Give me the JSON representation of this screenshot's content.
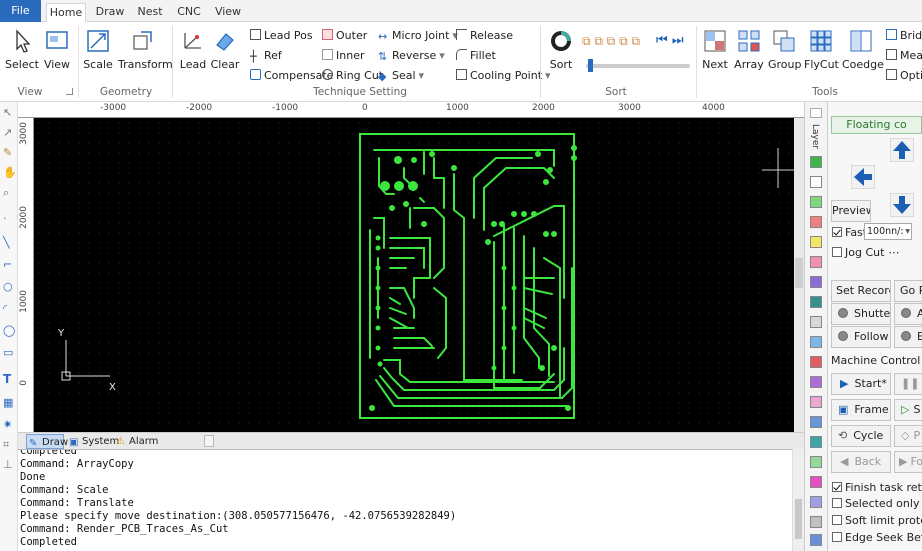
{
  "tabs": [
    "File",
    "Home",
    "Draw",
    "Nest",
    "CNC",
    "View"
  ],
  "ribbon": {
    "view_group": {
      "select": "Select",
      "view": "View",
      "label": "View"
    },
    "geometry_group": {
      "scale": "Scale",
      "transform": "Transform",
      "label": "Geometry"
    },
    "lead_clear": {
      "lead": "Lead",
      "clear": "Clear"
    },
    "technique": {
      "lead_pos": "Lead Pos",
      "ref": "Ref",
      "compensate": "Compensate",
      "outer": "Outer",
      "inner": "Inner",
      "ring_cut": "Ring Cut",
      "micro_joint": "Micro Joint",
      "reverse": "Reverse",
      "seal": "Seal",
      "release": "Release",
      "fillet": "Fillet",
      "cooling_point": "Cooling Point",
      "label": "Technique Setting"
    },
    "sort_group": {
      "sort": "Sort",
      "label": "Sort"
    },
    "tools_group": {
      "next": "Next",
      "array": "Array",
      "group": "Group",
      "flycut": "FlyCut",
      "coedge": "Coedge",
      "bridge": "Bridg",
      "measure": "Meas",
      "optimize": "Optin",
      "label": "Tools"
    }
  },
  "rulers": {
    "h": [
      "-3000",
      "-2000",
      "-1000",
      "0",
      "1000",
      "2000",
      "3000",
      "4000"
    ],
    "v": [
      "3000",
      "2000",
      "1000",
      "0"
    ]
  },
  "canvas": {
    "axis_y": "Y",
    "axis_x": "X"
  },
  "doc_tabs": [
    "Draw",
    "System",
    "Alarm"
  ],
  "console_lines": [
    "Completed",
    "Command: ArrayCopy",
    "Done",
    "Command: Scale",
    "Command: Translate",
    "Please specify move destination:(308.050577156476, -42.0756539282849)",
    "Command: Render_PCB_Traces_As_Cut",
    "Completed"
  ],
  "layer": {
    "title": "Layer"
  },
  "panel": {
    "floating": "Floating co",
    "preview": "Preview",
    "fast": "Fast",
    "speed": "100nn/:",
    "jog_cut": "Jog Cut",
    "set_record": "Set Record",
    "go_record": "Go Re",
    "shutter": "Shutter",
    "a_btn": "A",
    "follow": "Follow",
    "e_btn": "E",
    "machine_control": "Machine Control",
    "start": "Start*",
    "pause": "P",
    "frame": "Frame",
    "s_btn": "S",
    "cycle": "Cycle",
    "p_btn": "P",
    "back": "Back",
    "fo": "Fo",
    "finish_task": "Finish task return t",
    "selected_only": "Selected only",
    "soft_limit": "Soft limit protectio",
    "edge_seek": "Edge Seek Before"
  },
  "colors": {
    "accent": "#2b6bbd",
    "trace": "#38e23a",
    "canvas_bg": "#000000",
    "arrow": "#1a5fb4"
  }
}
